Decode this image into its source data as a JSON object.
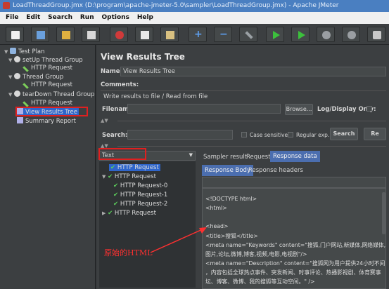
{
  "window": {
    "title": "LoadThreadGroup.jmx (D:\\program\\apache-jmeter-5.0\\sampler\\LoadThreadGroup.jmx) - Apache JMeter"
  },
  "menu": [
    "File",
    "Edit",
    "Search",
    "Run",
    "Options",
    "Help"
  ],
  "toolbar": [
    "new-icon",
    "templates-icon",
    "open-icon",
    "save-icon",
    "cut-icon",
    "copy-icon",
    "paste-icon",
    "expand-icon",
    "collapse-icon",
    "toggle-icon",
    "start-icon",
    "start-no-pause-icon",
    "stop-icon",
    "shutdown-icon",
    "clear-icon"
  ],
  "tree": {
    "items": [
      {
        "label": "Test Plan",
        "icon": "flask-icon"
      },
      {
        "label": "setUp Thread Group",
        "icon": "gear-icon"
      },
      {
        "label": "HTTP Request",
        "icon": "pen-icon"
      },
      {
        "label": "Thread Group",
        "icon": "gear-icon"
      },
      {
        "label": "HTTP Request",
        "icon": "pen-icon"
      },
      {
        "label": "tearDown Thread Group",
        "icon": "gear-icon"
      },
      {
        "label": "HTTP Request",
        "icon": "pen-icon"
      },
      {
        "label": "View Results Tree",
        "icon": "chart-icon"
      },
      {
        "label": "Summary Report",
        "icon": "chart-icon"
      }
    ]
  },
  "panel": {
    "title": "View Results Tree",
    "name_label": "Name:",
    "name_value": "View Results Tree",
    "comments_label": "Comments:",
    "write_label": "Write results to file / Read from file",
    "filename_label": "Filename",
    "browse_label": "Browse...",
    "log_label": "Log/Display Only:",
    "search_label": "Search:",
    "case_label": "Case sensitive",
    "regex_label": "Regular exp.",
    "search_button": "Search",
    "reset_button": "Re"
  },
  "renderer": {
    "selected": "Text"
  },
  "results": [
    {
      "label": "HTTP Request"
    },
    {
      "label": "HTTP Request"
    },
    {
      "label": "HTTP Request-0"
    },
    {
      "label": "HTTP Request-1"
    },
    {
      "label": "HTTP Request-2"
    },
    {
      "label": "HTTP Request"
    }
  ],
  "tabs": {
    "sampler": "Sampler result",
    "request": "Request",
    "response": "Response data"
  },
  "subtabs": {
    "body": "Response Body",
    "headers": "Response headers"
  },
  "code_lines": [
    "<!DOCTYPE html>",
    "<html>",
    "",
    "<head>",
    "<title>搜狐</title>",
    "<meta name=\"Keywords\" content=\"搜狐,门户网站,新媒体,网络媒体,新闻",
    "图片,论坛,微博,博客,视频,电影,电视剧\"/>",
    "<meta name=\"Description\" content=\"搜狐网为用户提供24小时不间断的",
    "，内容包括全球热点事件、突发新闻、时事评论、热播影视剧、体育赛事",
    "坛、博客、微博、我的搜狐等互动空间。\" />"
  ],
  "annotation": "原始的HTML",
  "colors": {
    "highlight_red": "#e02020",
    "selection": "#2f65ca",
    "accent_tab": "#4b6eaf"
  }
}
